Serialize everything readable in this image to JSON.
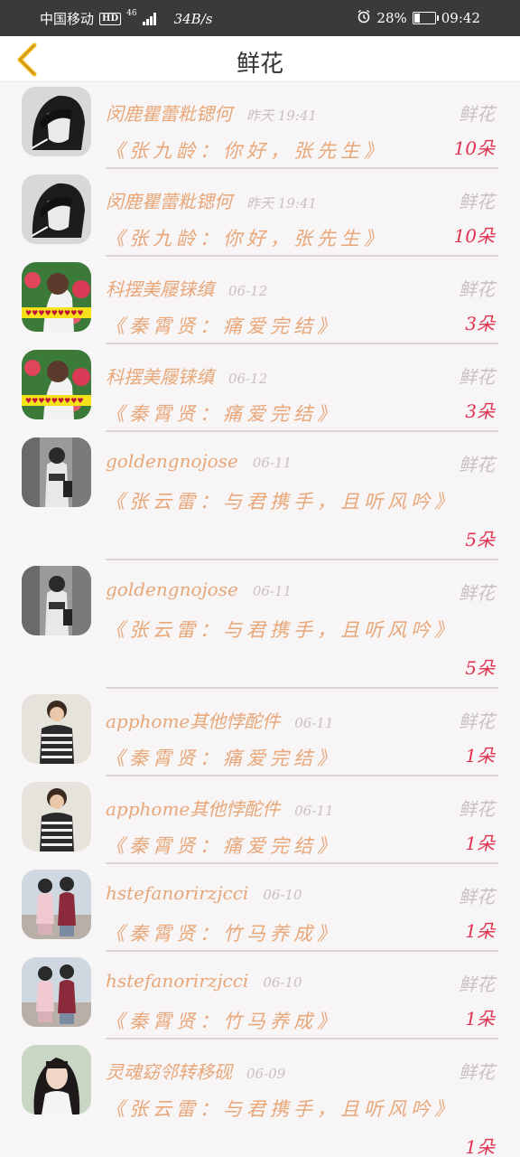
{
  "status": {
    "carrier": "中国移动",
    "hd": "HD",
    "network": "46",
    "speed": "34B/s",
    "battery": "28%",
    "battery_level": 0.28,
    "time": "09:42"
  },
  "nav": {
    "title": "鲜花"
  },
  "colors": {
    "accent": "#e8a779",
    "quantity": "#e0314f",
    "muted": "#c8c0c4",
    "back_arrow": "#f2b91f"
  },
  "list": [
    {
      "user": "闵鹿瞿蕾粃锶何",
      "time": "昨天 19:41",
      "gift": "鲜花",
      "work": "《张九龄：你好，张先生》",
      "qty": "10朵",
      "avatar_icon": "avatar-bw-girl-icon"
    },
    {
      "user": "闵鹿瞿蕾粃锶何",
      "time": "昨天 19:41",
      "gift": "鲜花",
      "work": "《张九龄：你好，张先生》",
      "qty": "10朵",
      "avatar_icon": "avatar-bw-girl-icon"
    },
    {
      "user": "科摆美屦铼缜",
      "time": "06-12",
      "gift": "鲜花",
      "work": "《秦霄贤：痛爱完结》",
      "qty": "3朵",
      "avatar_icon": "avatar-flowers-girl-icon"
    },
    {
      "user": "科摆美屦铼缜",
      "time": "06-12",
      "gift": "鲜花",
      "work": "《秦霄贤：痛爱完结》",
      "qty": "3朵",
      "avatar_icon": "avatar-flowers-girl-icon"
    },
    {
      "user": "goldengnojose",
      "time": "06-11",
      "gift": "鲜花",
      "work": "《张云雷：与君携手，且听风吟》",
      "qty": "5朵",
      "avatar_icon": "avatar-street-boy-icon"
    },
    {
      "user": "goldengnojose",
      "time": "06-11",
      "gift": "鲜花",
      "work": "《张云雷：与君携手，且听风吟》",
      "qty": "5朵",
      "avatar_icon": "avatar-street-boy-icon"
    },
    {
      "user": "apphome其他悖酡件",
      "time": "06-11",
      "gift": "鲜花",
      "work": "《秦霄贤：痛爱完结》",
      "qty": "1朵",
      "avatar_icon": "avatar-striped-boy-icon"
    },
    {
      "user": "apphome其他悖酡件",
      "time": "06-11",
      "gift": "鲜花",
      "work": "《秦霄贤：痛爱完结》",
      "qty": "1朵",
      "avatar_icon": "avatar-striped-boy-icon"
    },
    {
      "user": "hstefanorirzjcci",
      "time": "06-10",
      "gift": "鲜花",
      "work": "《秦霄贤：竹马养成》",
      "qty": "1朵",
      "avatar_icon": "avatar-couple-icon"
    },
    {
      "user": "hstefanorirzjcci",
      "time": "06-10",
      "gift": "鲜花",
      "work": "《秦霄贤：竹马养成》",
      "qty": "1朵",
      "avatar_icon": "avatar-couple-icon"
    },
    {
      "user": "灵魂窈邻转移砚",
      "time": "06-09",
      "gift": "鲜花",
      "work": "《张云雷：与君携手，且听风吟》",
      "qty": "1朵",
      "avatar_icon": "avatar-longhair-girl-icon"
    }
  ]
}
